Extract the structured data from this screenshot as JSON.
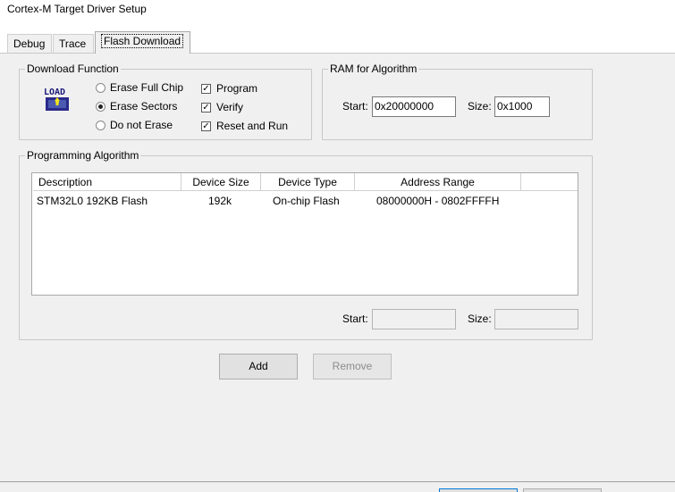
{
  "window": {
    "title": "Cortex-M Target Driver Setup"
  },
  "tabs": [
    {
      "label": "Debug",
      "active": false
    },
    {
      "label": "Trace",
      "active": false
    },
    {
      "label": "Flash Download",
      "active": true
    }
  ],
  "download_function": {
    "title": "Download Function",
    "icon_name": "load-icon",
    "icon_text": "LOAD",
    "erase_options": [
      {
        "label": "Erase Full Chip",
        "selected": false
      },
      {
        "label": "Erase Sectors",
        "selected": true
      },
      {
        "label": "Do not Erase",
        "selected": false
      }
    ],
    "actions": [
      {
        "label": "Program",
        "checked": true
      },
      {
        "label": "Verify",
        "checked": true
      },
      {
        "label": "Reset and Run",
        "checked": true
      }
    ]
  },
  "ram": {
    "title": "RAM for Algorithm",
    "start_label": "Start:",
    "start_value": "0x20000000",
    "size_label": "Size:",
    "size_value": "0x1000"
  },
  "programming": {
    "title": "Programming Algorithm",
    "columns": [
      "Description",
      "Device Size",
      "Device Type",
      "Address Range"
    ],
    "rows": [
      {
        "description": "STM32L0 192KB Flash",
        "device_size": "192k",
        "device_type": "On-chip Flash",
        "address_range": "08000000H - 0802FFFFH"
      }
    ],
    "start_label": "Start:",
    "start_value": "",
    "size_label": "Size:",
    "size_value": ""
  },
  "buttons": {
    "add": "Add",
    "remove": "Remove"
  }
}
